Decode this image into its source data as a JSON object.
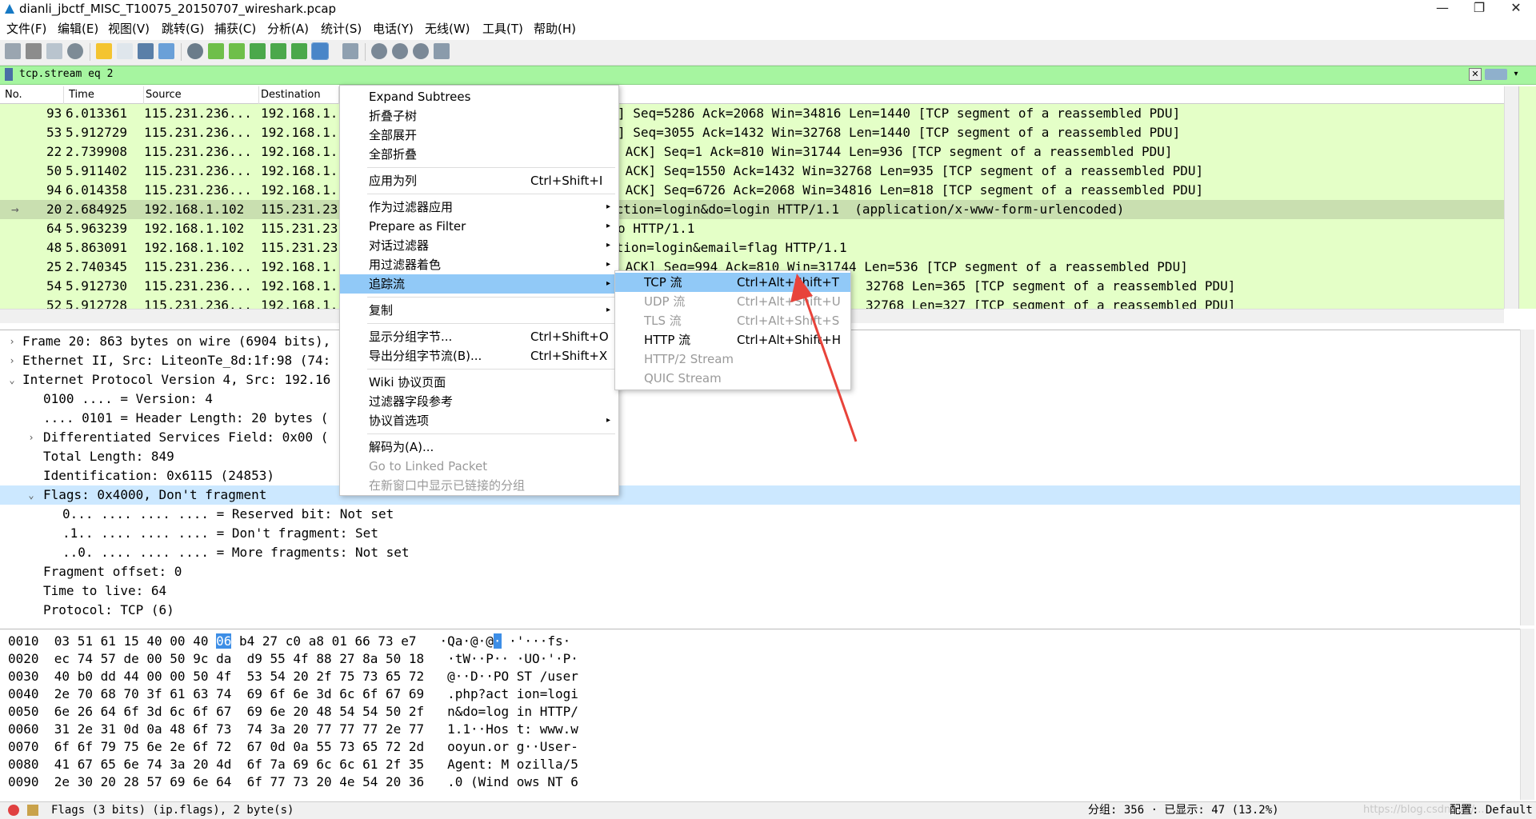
{
  "window": {
    "title": "dianli_jbctf_MISC_T10075_20150707_wireshark.pcap",
    "minimize": "—",
    "restore": "❐",
    "close": "✕"
  },
  "menubar": [
    "文件(F)",
    "编辑(E)",
    "视图(V)",
    "跳转(G)",
    "捕获(C)",
    "分析(A)",
    "统计(S)",
    "电话(Y)",
    "无线(W)",
    "工具(T)",
    "帮助(H)"
  ],
  "filter": {
    "value": "tcp.stream eq 2"
  },
  "packet_list": {
    "columns": [
      "No.",
      "Time",
      "Source",
      "Destination"
    ],
    "rows": [
      {
        "no": "93",
        "time": "6.013361",
        "src": "115.231.236...",
        "dst": "192.168.1.",
        "info": "] Seq=5286 Ack=2068 Win=34816 Len=1440 [TCP segment of a reassembled PDU]"
      },
      {
        "no": "53",
        "time": "5.912729",
        "src": "115.231.236...",
        "dst": "192.168.1.",
        "info": "] Seq=3055 Ack=1432 Win=32768 Len=1440 [TCP segment of a reassembled PDU]"
      },
      {
        "no": "22",
        "time": "2.739908",
        "src": "115.231.236...",
        "dst": "192.168.1.",
        "info": " ACK] Seq=1 Ack=810 Win=31744 Len=936 [TCP segment of a reassembled PDU]"
      },
      {
        "no": "50",
        "time": "5.911402",
        "src": "115.231.236...",
        "dst": "192.168.1.",
        "info": " ACK] Seq=1550 Ack=1432 Win=32768 Len=935 [TCP segment of a reassembled PDU]"
      },
      {
        "no": "94",
        "time": "6.014358",
        "src": "115.231.236...",
        "dst": "192.168.1.",
        "info": " ACK] Seq=6726 Ack=2068 Win=34816 Len=818 [TCP segment of a reassembled PDU]"
      },
      {
        "no": "20",
        "time": "2.684925",
        "src": "192.168.1.102",
        "dst": "115.231.23",
        "info": "action=login&do=login HTTP/1.1  (application/x-www-form-urlencoded)"
      },
      {
        "no": "64",
        "time": "5.963239",
        "src": "192.168.1.102",
        "dst": "115.231.23",
        "info": "o HTTP/1.1"
      },
      {
        "no": "48",
        "time": "5.863091",
        "src": "192.168.1.102",
        "dst": "115.231.23",
        "info": "ction=login&email=flag HTTP/1.1"
      },
      {
        "no": "25",
        "time": "2.740345",
        "src": "115.231.236...",
        "dst": "192.168.1.",
        "info": " ACK] Seq=994 Ack=810 Win=31744 Len=536 [TCP segment of a reassembled PDU]"
      },
      {
        "no": "54",
        "time": "5.912730",
        "src": "115.231.236...",
        "dst": "192.168.1.",
        "info": "32768 Len=365 [TCP segment of a reassembled PDU]"
      },
      {
        "no": "52",
        "time": "5.912728",
        "src": "115.231.236...",
        "dst": "192.168.1.",
        "info": "32768 Len=327 [TCP segment of a reassembled PDU]"
      }
    ]
  },
  "details": [
    {
      "arrow": "›",
      "text": "Frame 20: 863 bytes on wire (6904 bits),"
    },
    {
      "arrow": "›",
      "text": "Ethernet II, Src: LiteonTe_8d:1f:98 (74:"
    },
    {
      "arrow": "⌄",
      "text": "Internet Protocol Version 4, Src: 192.16"
    },
    {
      "arrow": "",
      "text": "0100 .... = Version: 4"
    },
    {
      "arrow": "",
      "text": ".... 0101 = Header Length: 20 bytes ("
    },
    {
      "arrow": "›",
      "text": "Differentiated Services Field: 0x00 ("
    },
    {
      "arrow": "",
      "text": "Total Length: 849"
    },
    {
      "arrow": "",
      "text": "Identification: 0x6115 (24853)"
    },
    {
      "arrow": "⌄",
      "text": "Flags: 0x4000, Don't fragment"
    },
    {
      "arrow": "",
      "text": "0... .... .... .... = Reserved bit: Not set"
    },
    {
      "arrow": "",
      "text": ".1.. .... .... .... = Don't fragment: Set"
    },
    {
      "arrow": "",
      "text": "..0. .... .... .... = More fragments: Not set"
    },
    {
      "arrow": "",
      "text": "Fragment offset: 0"
    },
    {
      "arrow": "",
      "text": "Time to live: 64"
    },
    {
      "arrow": "",
      "text": "Protocol: TCP (6)"
    }
  ],
  "bytes": [
    {
      "off": "0010",
      "hexa": "03 51 61 15 40 00 40 ",
      "hl": "06",
      "hexb": " b4 27 c0 a8 01 66 73 e7",
      "ascA": "·Qa·@·@",
      "ascHl": "·",
      "ascB": " ·'···fs·"
    },
    {
      "off": "0020",
      "hexa": "ec 74 57 de 00 50 9c da",
      "hl": "",
      "hexb": "  d9 55 4f 88 27 8a 50 18",
      "ascA": "·tW··P··",
      "ascHl": "",
      "ascB": " ·UO·'·P·"
    },
    {
      "off": "0030",
      "hexa": "40 b0 dd 44 00 00 50 4f",
      "hl": "",
      "hexb": "  53 54 20 2f 75 73 65 72",
      "ascA": "@··D··PO",
      "ascHl": "",
      "ascB": " ST /user"
    },
    {
      "off": "0040",
      "hexa": "2e 70 68 70 3f 61 63 74",
      "hl": "",
      "hexb": "  69 6f 6e 3d 6c 6f 67 69",
      "ascA": ".php?act",
      "ascHl": "",
      "ascB": " ion=logi"
    },
    {
      "off": "0050",
      "hexa": "6e 26 64 6f 3d 6c 6f 67",
      "hl": "",
      "hexb": "  69 6e 20 48 54 54 50 2f",
      "ascA": "n&do=log",
      "ascHl": "",
      "ascB": " in HTTP/"
    },
    {
      "off": "0060",
      "hexa": "31 2e 31 0d 0a 48 6f 73",
      "hl": "",
      "hexb": "  74 3a 20 77 77 77 2e 77",
      "ascA": "1.1··Hos",
      "ascHl": "",
      "ascB": " t: www.w"
    },
    {
      "off": "0070",
      "hexa": "6f 6f 79 75 6e 2e 6f 72",
      "hl": "",
      "hexb": "  67 0d 0a 55 73 65 72 2d",
      "ascA": "ooyun.or",
      "ascHl": "",
      "ascB": " g··User-"
    },
    {
      "off": "0080",
      "hexa": "41 67 65 6e 74 3a 20 4d",
      "hl": "",
      "hexb": "  6f 7a 69 6c 6c 61 2f 35",
      "ascA": "Agent: M",
      "ascHl": "",
      "ascB": " ozilla/5"
    },
    {
      "off": "0090",
      "hexa": "2e 30 20 28 57 69 6e 64",
      "hl": "",
      "hexb": "  6f 77 73 20 4e 54 20 36",
      "ascA": ".0 (Wind",
      "ascHl": "",
      "ascB": " ows NT 6"
    }
  ],
  "context_menu": [
    {
      "label": "Expand Subtrees",
      "shortcut": "",
      "sub": false,
      "dis": false
    },
    {
      "label": "折叠子树",
      "shortcut": "",
      "sub": false,
      "dis": false
    },
    {
      "label": "全部展开",
      "shortcut": "",
      "sub": false,
      "dis": false
    },
    {
      "label": "全部折叠",
      "shortcut": "",
      "sub": false,
      "dis": false
    },
    {
      "sep": true
    },
    {
      "label": "应用为列",
      "shortcut": "Ctrl+Shift+I",
      "sub": false,
      "dis": false
    },
    {
      "sep": true
    },
    {
      "label": "作为过滤器应用",
      "shortcut": "",
      "sub": true,
      "dis": false
    },
    {
      "label": "Prepare as Filter",
      "shortcut": "",
      "sub": true,
      "dis": false
    },
    {
      "label": "对话过滤器",
      "shortcut": "",
      "sub": true,
      "dis": false
    },
    {
      "label": "用过滤器着色",
      "shortcut": "",
      "sub": true,
      "dis": false
    },
    {
      "label": "追踪流",
      "shortcut": "",
      "sub": true,
      "dis": false,
      "hov": true
    },
    {
      "sep": true
    },
    {
      "label": "复制",
      "shortcut": "",
      "sub": true,
      "dis": false
    },
    {
      "sep": true
    },
    {
      "label": "显示分组字节...",
      "shortcut": "Ctrl+Shift+O",
      "sub": false,
      "dis": false
    },
    {
      "label": "导出分组字节流(B)...",
      "shortcut": "Ctrl+Shift+X",
      "sub": false,
      "dis": false
    },
    {
      "sep": true
    },
    {
      "label": "Wiki 协议页面",
      "shortcut": "",
      "sub": false,
      "dis": false
    },
    {
      "label": "过滤器字段参考",
      "shortcut": "",
      "sub": false,
      "dis": false
    },
    {
      "label": "协议首选项",
      "shortcut": "",
      "sub": true,
      "dis": false
    },
    {
      "sep": true
    },
    {
      "label": "解码为(A)...",
      "shortcut": "",
      "sub": false,
      "dis": false
    },
    {
      "label": "Go to Linked Packet",
      "shortcut": "",
      "sub": false,
      "dis": true
    },
    {
      "label": "在新窗口中显示已链接的分组",
      "shortcut": "",
      "sub": false,
      "dis": true
    }
  ],
  "submenu": [
    {
      "label": "TCP 流",
      "shortcut": "Ctrl+Alt+Shift+T",
      "dis": false,
      "hov": true
    },
    {
      "label": "UDP 流",
      "shortcut": "Ctrl+Alt+Shift+U",
      "dis": true
    },
    {
      "label": "TLS 流",
      "shortcut": "Ctrl+Alt+Shift+S",
      "dis": true
    },
    {
      "label": "HTTP 流",
      "shortcut": "Ctrl+Alt+Shift+H",
      "dis": false
    },
    {
      "label": "HTTP/2 Stream",
      "shortcut": "",
      "dis": true
    },
    {
      "label": "QUIC Stream",
      "shortcut": "",
      "dis": true
    }
  ],
  "status": {
    "field": "Flags (3 bits) (ip.flags), 2 byte(s)",
    "packets": "分组: 356 · 已显示: 47 (13.2%)",
    "profile": "配置: Default"
  },
  "watermark": "https://blog.csdn.net/...",
  "colors": {
    "filter_bg": "#a6f5a0",
    "row_bg": "#e4ffc7",
    "selection": "#91c9f7",
    "annotation_arrow": "#e8433a"
  }
}
